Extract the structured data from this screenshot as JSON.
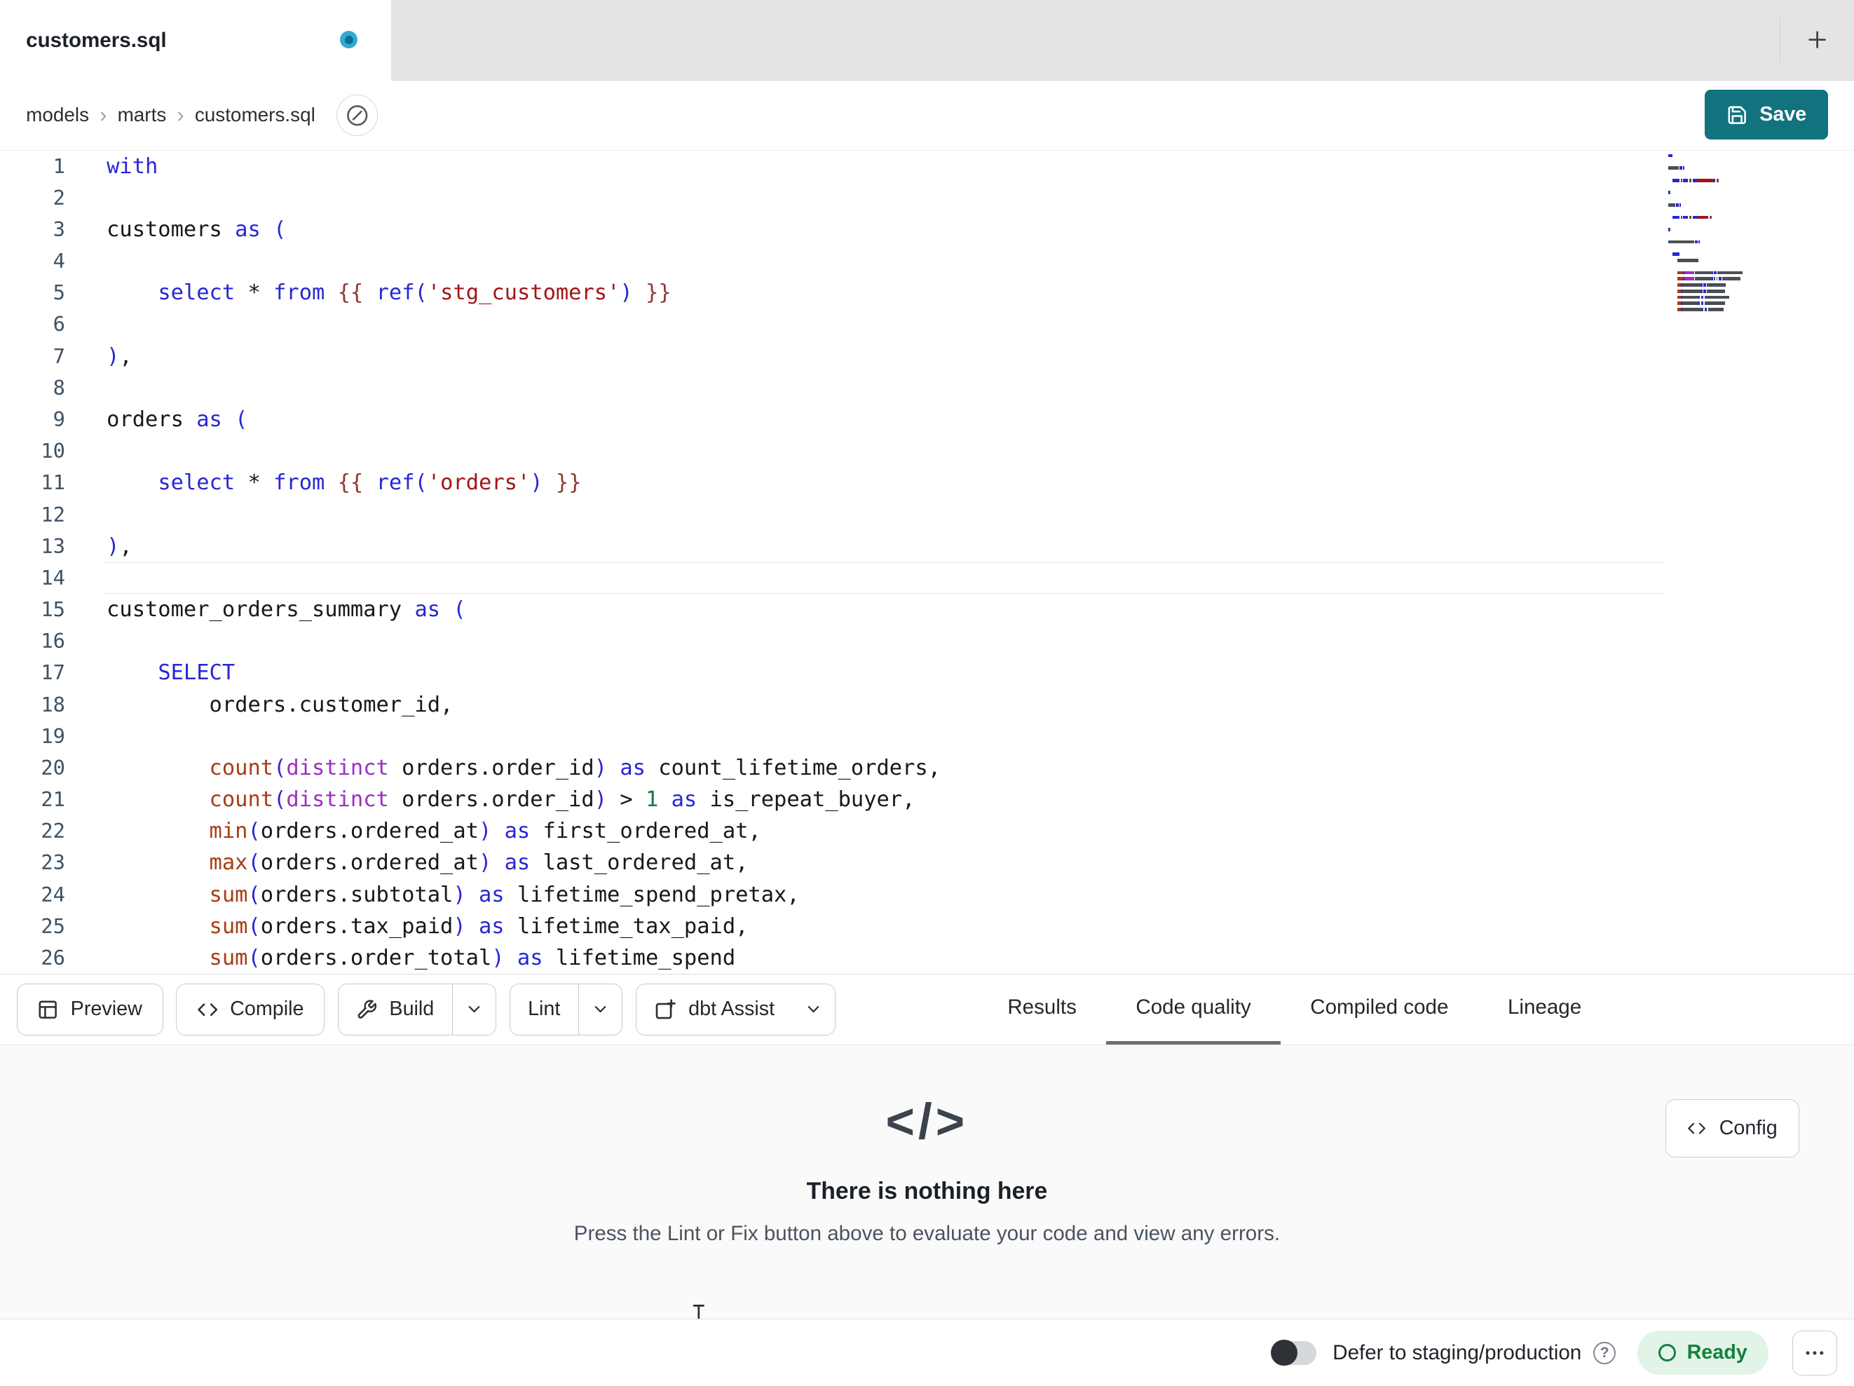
{
  "tab_bar": {
    "active_tab": "customers.sql"
  },
  "breadcrumb": {
    "items": [
      "models",
      "marts",
      "customers.sql"
    ]
  },
  "actions": {
    "save": "Save",
    "config": "Config"
  },
  "toolbar": {
    "preview": "Preview",
    "compile": "Compile",
    "build": "Build",
    "lint": "Lint",
    "assist": "dbt Assist"
  },
  "result_tabs": [
    {
      "label": "Results",
      "active": false
    },
    {
      "label": "Code quality",
      "active": true
    },
    {
      "label": "Compiled code",
      "active": false
    },
    {
      "label": "Lineage",
      "active": false
    }
  ],
  "editor": {
    "active_line": 14,
    "lines": [
      {
        "n": 1,
        "t": [
          [
            "with",
            "kw"
          ]
        ]
      },
      {
        "n": 2,
        "t": []
      },
      {
        "n": 3,
        "t": [
          [
            "customers ",
            "tx"
          ],
          [
            "as",
            "kw"
          ],
          [
            " ",
            "tx"
          ],
          [
            "(",
            "kw"
          ]
        ]
      },
      {
        "n": 4,
        "t": []
      },
      {
        "n": 5,
        "t": [
          [
            "    ",
            "tx"
          ],
          [
            "select",
            "kw"
          ],
          [
            " ",
            "tx"
          ],
          [
            "*",
            "tx"
          ],
          [
            " ",
            "tx"
          ],
          [
            "from",
            "kw"
          ],
          [
            " ",
            "tx"
          ],
          [
            "{{",
            "jj"
          ],
          [
            " ",
            "tx"
          ],
          [
            "ref",
            "kw"
          ],
          [
            "(",
            "kw"
          ],
          [
            "'stg_customers'",
            "st"
          ],
          [
            ")",
            "kw"
          ],
          [
            " ",
            "tx"
          ],
          [
            "}}",
            "jj"
          ]
        ]
      },
      {
        "n": 6,
        "t": []
      },
      {
        "n": 7,
        "t": [
          [
            ")",
            "kw"
          ],
          [
            ",",
            "tx"
          ]
        ]
      },
      {
        "n": 8,
        "t": []
      },
      {
        "n": 9,
        "t": [
          [
            "orders ",
            "tx"
          ],
          [
            "as",
            "kw"
          ],
          [
            " ",
            "tx"
          ],
          [
            "(",
            "kw"
          ]
        ]
      },
      {
        "n": 10,
        "t": []
      },
      {
        "n": 11,
        "t": [
          [
            "    ",
            "tx"
          ],
          [
            "select",
            "kw"
          ],
          [
            " ",
            "tx"
          ],
          [
            "*",
            "tx"
          ],
          [
            " ",
            "tx"
          ],
          [
            "from",
            "kw"
          ],
          [
            " ",
            "tx"
          ],
          [
            "{{",
            "jj"
          ],
          [
            " ",
            "tx"
          ],
          [
            "ref",
            "kw"
          ],
          [
            "(",
            "kw"
          ],
          [
            "'orders'",
            "st"
          ],
          [
            ")",
            "kw"
          ],
          [
            " ",
            "tx"
          ],
          [
            "}}",
            "jj"
          ]
        ]
      },
      {
        "n": 12,
        "t": []
      },
      {
        "n": 13,
        "t": [
          [
            ")",
            "kw"
          ],
          [
            ",",
            "tx"
          ]
        ]
      },
      {
        "n": 14,
        "t": []
      },
      {
        "n": 15,
        "t": [
          [
            "customer_orders_summary ",
            "tx"
          ],
          [
            "as",
            "kw"
          ],
          [
            " ",
            "tx"
          ],
          [
            "(",
            "kw"
          ]
        ]
      },
      {
        "n": 16,
        "t": []
      },
      {
        "n": 17,
        "t": [
          [
            "    ",
            "tx"
          ],
          [
            "SELECT",
            "kw"
          ]
        ]
      },
      {
        "n": 18,
        "t": [
          [
            "        orders.customer_id,",
            "tx"
          ]
        ]
      },
      {
        "n": 19,
        "t": []
      },
      {
        "n": 20,
        "t": [
          [
            "        ",
            "tx"
          ],
          [
            "count",
            "fn"
          ],
          [
            "(",
            "kw"
          ],
          [
            "distinct",
            "di"
          ],
          [
            " orders.order_id",
            "tx"
          ],
          [
            ")",
            "kw"
          ],
          [
            " ",
            "tx"
          ],
          [
            "as",
            "kw"
          ],
          [
            " count_lifetime_orders,",
            "tx"
          ]
        ]
      },
      {
        "n": 21,
        "t": [
          [
            "        ",
            "tx"
          ],
          [
            "count",
            "fn"
          ],
          [
            "(",
            "kw"
          ],
          [
            "distinct",
            "di"
          ],
          [
            " orders.order_id",
            "tx"
          ],
          [
            ")",
            "kw"
          ],
          [
            " > ",
            "tx"
          ],
          [
            "1",
            "nu"
          ],
          [
            " ",
            "tx"
          ],
          [
            "as",
            "kw"
          ],
          [
            " is_repeat_buyer,",
            "tx"
          ]
        ]
      },
      {
        "n": 22,
        "t": [
          [
            "        ",
            "tx"
          ],
          [
            "min",
            "fn"
          ],
          [
            "(",
            "kw"
          ],
          [
            "orders.ordered_at",
            "tx"
          ],
          [
            ")",
            "kw"
          ],
          [
            " ",
            "tx"
          ],
          [
            "as",
            "kw"
          ],
          [
            " first_ordered_at,",
            "tx"
          ]
        ]
      },
      {
        "n": 23,
        "t": [
          [
            "        ",
            "tx"
          ],
          [
            "max",
            "fn"
          ],
          [
            "(",
            "kw"
          ],
          [
            "orders.ordered_at",
            "tx"
          ],
          [
            ")",
            "kw"
          ],
          [
            " ",
            "tx"
          ],
          [
            "as",
            "kw"
          ],
          [
            " last_ordered_at,",
            "tx"
          ]
        ]
      },
      {
        "n": 24,
        "t": [
          [
            "        ",
            "tx"
          ],
          [
            "sum",
            "fn"
          ],
          [
            "(",
            "kw"
          ],
          [
            "orders.subtotal",
            "tx"
          ],
          [
            ")",
            "kw"
          ],
          [
            " ",
            "tx"
          ],
          [
            "as",
            "kw"
          ],
          [
            " lifetime_spend_pretax,",
            "tx"
          ]
        ]
      },
      {
        "n": 25,
        "t": [
          [
            "        ",
            "tx"
          ],
          [
            "sum",
            "fn"
          ],
          [
            "(",
            "kw"
          ],
          [
            "orders.tax_paid",
            "tx"
          ],
          [
            ")",
            "kw"
          ],
          [
            " ",
            "tx"
          ],
          [
            "as",
            "kw"
          ],
          [
            " lifetime_tax_paid,",
            "tx"
          ]
        ]
      },
      {
        "n": 26,
        "t": [
          [
            "        ",
            "tx"
          ],
          [
            "sum",
            "fn"
          ],
          [
            "(",
            "kw"
          ],
          [
            "orders.order_total",
            "tx"
          ],
          [
            ")",
            "kw"
          ],
          [
            " ",
            "tx"
          ],
          [
            "as",
            "kw"
          ],
          [
            " lifetime_spend",
            "tx"
          ]
        ]
      }
    ]
  },
  "empty_state": {
    "title": "There is nothing here",
    "subtitle": "Press the Lint or Fix button above to evaluate your code and view any errors."
  },
  "status_bar": {
    "defer_label": "Defer to staging/production",
    "ready_label": "Ready"
  },
  "colors": {
    "save_button": "#12737e",
    "tab_underline": "#6a7078",
    "ready_text": "#15803d",
    "ready_bg": "#e2f3e8",
    "unsaved_dot_outer": "#35a9cf",
    "unsaved_dot_inner": "#0b6e9b",
    "syntax": {
      "kw": "#2727d4",
      "fn": "#a63d17",
      "st": "#a31515",
      "jj": "#8f3a2e",
      "di": "#9b2fc0",
      "nu": "#0f7b3f",
      "tx": "#16181d",
      "gutter": "#3e5263"
    }
  }
}
